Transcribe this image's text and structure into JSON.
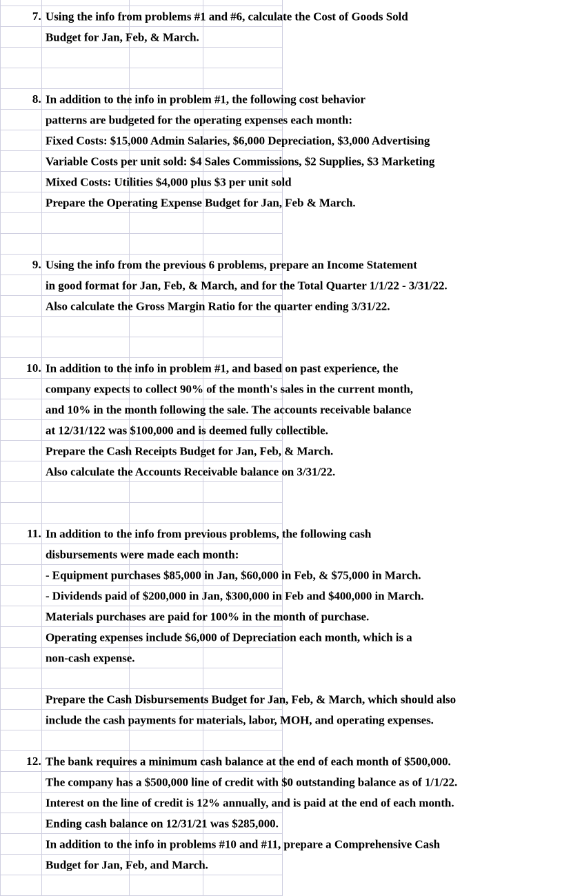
{
  "document": {
    "type": "spreadsheet",
    "title": "Budget Problems Worksheet",
    "grid": {
      "line_color": "#cfcfe0",
      "columns": 4,
      "visible_rows": 43
    }
  },
  "rows": [
    {
      "num": "",
      "text": ""
    },
    {
      "num": "7.",
      "text": "Using the info from problems #1 and #6, calculate the Cost of Goods Sold"
    },
    {
      "num": "",
      "text": "Budget for Jan, Feb, & March."
    },
    {
      "num": "",
      "text": ""
    },
    {
      "num": "",
      "text": ""
    },
    {
      "num": "8.",
      "text": "In addition to the info in problem #1, the following cost behavior"
    },
    {
      "num": "",
      "text": "patterns are budgeted for the operating expenses each month:"
    },
    {
      "num": "",
      "text": "Fixed Costs: $15,000 Admin Salaries, $6,000 Depreciation, $3,000 Advertising"
    },
    {
      "num": "",
      "text": "Variable Costs per unit sold: $4 Sales Commissions, $2 Supplies, $3 Marketing"
    },
    {
      "num": "",
      "text": "Mixed Costs:  Utilities $4,000 plus $3 per unit sold"
    },
    {
      "num": "",
      "text": "Prepare the Operating Expense Budget for Jan, Feb & March."
    },
    {
      "num": "",
      "text": ""
    },
    {
      "num": "",
      "text": ""
    },
    {
      "num": "9.",
      "text": "Using the info from the previous 6 problems, prepare an Income Statement"
    },
    {
      "num": "",
      "text": "in good format for Jan, Feb, & March, and for the Total Quarter 1/1/22 - 3/31/22."
    },
    {
      "num": "",
      "text": "Also calculate the Gross Margin Ratio for the quarter ending 3/31/22."
    },
    {
      "num": "",
      "text": ""
    },
    {
      "num": "",
      "text": ""
    },
    {
      "num": "10.",
      "text": "In addition to the info in problem #1, and based on past experience, the"
    },
    {
      "num": "",
      "text": "company expects to collect 90% of the month's sales in the current month,"
    },
    {
      "num": "",
      "text": "and 10% in the month following the sale.  The accounts receivable balance"
    },
    {
      "num": "",
      "text": "at 12/31/122 was $100,000 and is deemed fully collectible."
    },
    {
      "num": "",
      "text": "Prepare the Cash Receipts Budget for Jan, Feb, & March."
    },
    {
      "num": "",
      "text": "Also calculate the Accounts Receivable balance on 3/31/22."
    },
    {
      "num": "",
      "text": ""
    },
    {
      "num": "",
      "text": ""
    },
    {
      "num": "11.",
      "text": "In addition to the info from previous problems, the following cash"
    },
    {
      "num": "",
      "text": "disbursements were made each month:"
    },
    {
      "num": "",
      "text": " - Equipment purchases $85,000 in Jan, $60,000 in Feb, & $75,000 in March."
    },
    {
      "num": "",
      "text": " - Dividends paid of $200,000 in Jan, $300,000 in Feb and $400,000 in March."
    },
    {
      "num": "",
      "text": "Materials purchases are paid for 100% in the month of purchase."
    },
    {
      "num": "",
      "text": "Operating expenses include $6,000 of Depreciation each month, which is a"
    },
    {
      "num": "",
      "text": "non-cash expense."
    },
    {
      "num": "",
      "text": ""
    },
    {
      "num": "",
      "text": "Prepare the Cash Disbursements Budget for Jan, Feb, & March, which should also"
    },
    {
      "num": "",
      "text": "include the cash payments for materials, labor, MOH, and operating expenses."
    },
    {
      "num": "",
      "text": ""
    },
    {
      "num": "12.",
      "text": "The bank requires a minimum cash balance at the end of each month of $500,000."
    },
    {
      "num": "",
      "text": "The company has a $500,000 line of credit with $0 outstanding balance as of 1/1/22."
    },
    {
      "num": "",
      "text": "Interest on the line of credit is 12% annually, and is paid at the end of each month."
    },
    {
      "num": "",
      "text": "Ending cash balance on 12/31/21 was $285,000."
    },
    {
      "num": "",
      "text": "In addition to the info in problems #10 and #11, prepare a Comprehensive Cash"
    },
    {
      "num": "",
      "text": "Budget for Jan, Feb, and March."
    },
    {
      "num": "",
      "text": ""
    }
  ]
}
